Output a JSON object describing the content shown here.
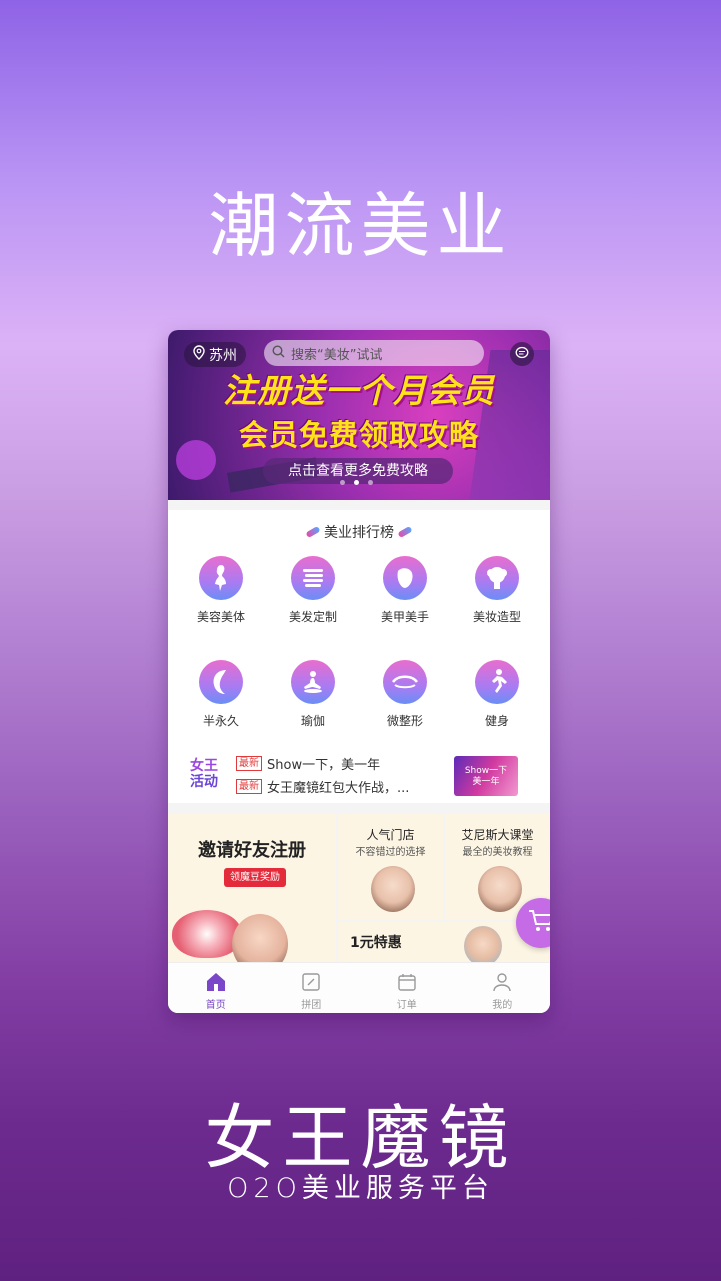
{
  "promo": {
    "headline_top": "潮流美业",
    "app_name": "女王魔镜",
    "tagline": "O2O美业服务平台"
  },
  "header": {
    "location": "苏州",
    "search_placeholder": "搜索“美妆”试试"
  },
  "banner": {
    "title": "注册送一个月会员",
    "subtitle": "会员免费领取攻略",
    "button": "点击查看更多免费攻略",
    "pages": 3,
    "active_page": 2
  },
  "ranking": {
    "title": "美业排行榜",
    "categories": [
      {
        "label": "美容美体",
        "icon": "beauty-body-icon"
      },
      {
        "label": "美发定制",
        "icon": "hair-icon"
      },
      {
        "label": "美甲美手",
        "icon": "nail-icon"
      },
      {
        "label": "美妆造型",
        "icon": "makeup-icon"
      },
      {
        "label": "半永久",
        "icon": "face-profile-icon"
      },
      {
        "label": "瑜伽",
        "icon": "yoga-icon"
      },
      {
        "label": "微整形",
        "icon": "eye-icon"
      },
      {
        "label": "健身",
        "icon": "running-icon"
      }
    ]
  },
  "news": {
    "brand_line1": "女王",
    "brand_line2": "活动",
    "items": [
      {
        "tag": "最新",
        "text": "Show一下，美一年"
      },
      {
        "tag": "最新",
        "text": "女王魔镜红包大作战，..."
      }
    ],
    "thumb_line1": "Show一下",
    "thumb_line2": "美一年"
  },
  "grid": {
    "invite_title": "邀请好友注册",
    "invite_badge": "领魔豆奖励",
    "shop_title": "人气门店",
    "shop_sub": "不容错过的选择",
    "class_title": "艾尼斯大课堂",
    "class_sub": "最全的美妆教程",
    "deal_title": "1元特惠"
  },
  "tabs": [
    {
      "label": "首页",
      "icon": "home-icon",
      "active": true
    },
    {
      "label": "拼团",
      "icon": "group-buy-icon",
      "active": false
    },
    {
      "label": "订单",
      "icon": "calendar-icon",
      "active": false
    },
    {
      "label": "我的",
      "icon": "user-icon",
      "active": false
    }
  ],
  "colors": {
    "accent": "#7a47c9",
    "banner_title": "#ffe21a",
    "tag_red": "#e23a3a"
  }
}
